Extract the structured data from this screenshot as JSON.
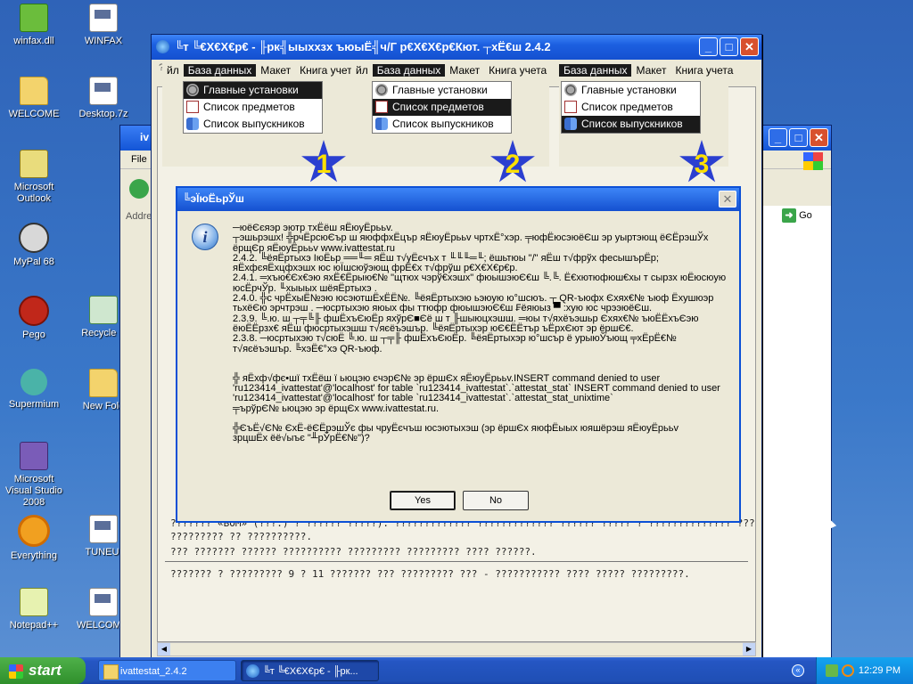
{
  "desktop": {
    "icons": [
      {
        "label": "winfax.dll"
      },
      {
        "label": "WINFAX"
      },
      {
        "label": "WELCOME"
      },
      {
        "label": "Desktop.7z"
      },
      {
        "label": "Microsoft Outlook"
      },
      {
        "label": "MyPal 68"
      },
      {
        "label": "Pego"
      },
      {
        "label": "Recycle B"
      },
      {
        "label": "Supermium"
      },
      {
        "label": "New Fold"
      },
      {
        "label": "Microsoft Visual Studio 2008"
      },
      {
        "label": "Everything"
      },
      {
        "label": "TUNEUI"
      },
      {
        "label": "Notepad++"
      },
      {
        "label": "WELCOME."
      }
    ]
  },
  "back_window": {
    "title": "iv",
    "menu_file": "File",
    "address_label": "Addre",
    "go_label": "Go"
  },
  "main_window": {
    "title": "╚т ╚€Х€Х€р€ - ╟рк╣ыыххзх ъюыЁ╣ч/Г р€Х€Х€р€Кют. ┬хЁ€ш 2.4.2",
    "menu": [
      "????",
      "??? ??????",
      "????",
      "???? ?????",
      "?? ????",
      "??????"
    ],
    "content_lines": [
      "??????? «BOM» (???.) ? ?????? ?????). ????????????? ????????????? ?????? ????? ? ?????????????? ????????",
      "????????? ?? ??????????.",
      "??? ??????? ?????? ?????????? ????????? ????????? ???? ??????.",
      "??????? ? ????????? 9 ? 11 ??????? ??? ????????? ??? - ??????????? ???? ????? ?????????."
    ],
    "left_stub_lines": [
      "??",
      "??",
      "??",
      "??",
      "??",
      "??",
      "(1",
      "??",
      "??",
      "\"?",
      "??",
      "??",
      "??",
      "??",
      "??",
      "\""
    ],
    "right_stub_lines": [
      "???",
      "??",
      "??",
      "??",
      ".??",
      "??",
      "??",
      ".??",
      "??",
      "???",
      "??",
      "??",
      "??",
      "??",
      "??",
      ".??",
      "???"
    ]
  },
  "menu_shots": [
    {
      "bar": [
        "йл",
        "База данных",
        "Макет",
        "Книга учета"
      ],
      "items": [
        "Главные установки",
        "Список предметов",
        "Список выпускников"
      ],
      "selected": 0,
      "badge": "1"
    },
    {
      "bar": [
        "йл",
        "База данных",
        "Макет",
        "Книга учета"
      ],
      "items": [
        "Главные установки",
        "Список предметов",
        "Список выпускников"
      ],
      "selected": 1,
      "badge": "2"
    },
    {
      "bar": [
        "База данных",
        "Макет",
        "Книга учета"
      ],
      "items": [
        "Главные установки",
        "Список предметов",
        "Список выпускников"
      ],
      "selected": 2,
      "badge": "3"
    }
  ],
  "dialog": {
    "title": "╚эЇюЁьрЎш",
    "close": "✕",
    "lines": [
      "─юёЄєяэр эютр  тхЁёш  яЁюуЁрььv.",
      "┬эшьрэшх! ╬рчЁрсюЄър ш яюффхЁцър яЁюуЁрььv чртхЁ°хэр. ╤юфЁюсэюёЄш эр уыртэющ ёЄЁрэшЎх",
      "ёрщЄр яЁюуЁрььv www.ivattestat.ru",
      "2.4.2. ╚ёяЁртыхэ ІюЁьр ══╙═ яЁш т√уЁєчъх т  ╙╙╙═╙; ёшьтюы \"/\" яЁш т√фрўх фесышърЁр;",
      "яЁхфєяЁхцфхэшх юс юЇшсюўэющ фрЁ€х т√фрўш р€Х€Х€р€р.",
      "2.4.1. ═хъю€Єх€эю яхЁ€Ёрыю€№ \"щтюх чэрў€хэшх\" фюышэюЄ€ш ╚.╚. Ё€хютюфюш€хы  т сырзх юЁюсюую",
      "юсЁрчЎр. ╙хыыых шёяЁртыхэ .",
      "2.4.0. ╬с чрЁхыЁ№эю юсэютшЁхЁЁ№. ╚ёяЁртыхэю ьэюую ю°шсюъ. ┬ QR-ъюфх Єхях€№ ъюф Ёхушюэр",
      "тьхёЄю эрчтрэш . ─юсртыхэю яюых фы  ттюфр фюышэюЄ€ш ₣ёяюыз ▀ :хую юс чрээюёЄш.",
      "2.3.9. ╚.ю. ш ┬╤╚╟ фшЁхъЄюЁр яхўрЄ■Єё  ш т ╟шыюцхэшш. ═юы т√яхёъэшьр Єхях€№ ъюЁЁхъЄэю",
      "ёюЁЁрзх€ яЁш фюсртыхэшш т√яєёъэшър. ╚ёяЁртыхэр юЄ€ЁЁтър ъЁрхЄют эр ёршЄ€.",
      "2.3.8. ─юсртыхэю т√сюЁ ╚.ю. ш ┬╤╟ фшЁхъЄюЁр. ╚ёяЁртыхэр ю°шсър ё урыюЎъющ ╤хЁрЁ€№",
      "т√яєёъэшър. ╚хэЁ€°хэ QR-ъюф.",
      "",
      "╬ яЁхф√фє•шї тхЁёш ї ьюцэю єчэрЄ№ эр ёршЄх яЁюуЁрььv.INSERT command denied to user",
      "'ru123414_ivattestat'@'localhost' for table `ru123414_ivattestat`.`attestat_stat` INSERT command denied to user",
      "'ru123414_ivattestat'@'localhost' for table `ru123414_ivattestat`.`attestat_stat_unixtime`",
      "╤ърўрЄ№ ьюцэю эр ёрщЄх www.ivattestat.ru.",
      "",
      "╬ЄъЁ√Є№ ЄхЁ-ёЄЁрэшЎє фы  чруЁєчъш юсэютыхэш  (эр ёршЄх яюфЁыых юяшёрэш  яЁюуЁрььv",
      "зрцшЁх ёё√ыъє \"╨рЎрЁ€№\")?"
    ],
    "yes_label": "Yes",
    "no_label": "No"
  },
  "taskbar": {
    "start_label": "start",
    "tasks": [
      "ivattestat_2.4.2",
      "╚т ╚€Х€Х€р€ - ╟рк..."
    ],
    "clock": "12:29 PM"
  }
}
